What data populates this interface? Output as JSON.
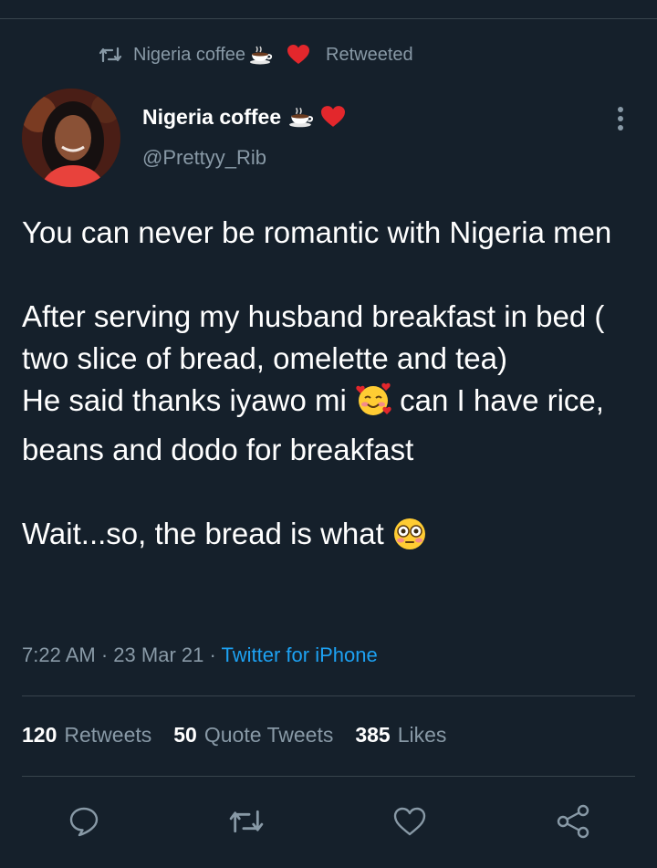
{
  "retweet_bar": {
    "name": "Nigeria coffee",
    "suffix": "Retweeted",
    "icon": "retweet-icon"
  },
  "author": {
    "name": "Nigeria coffee",
    "handle": "@Prettyy_Rib",
    "emojis": [
      "hot-beverage",
      "red-heart"
    ]
  },
  "tweet": {
    "para1": "You can never be romantic with Nigeria men",
    "para2_line1": "After serving my husband breakfast in bed ( two slice of bread, omelette and tea)",
    "para2_line2_before": "He said thanks iyawo mi",
    "para2_line2_after": "can I have rice, beans and dodo for breakfast",
    "para3_before": "Wait...so, the bread is what"
  },
  "meta": {
    "time": "7:22 AM",
    "sep": "·",
    "date": "23 Mar 21",
    "source": "Twitter for iPhone"
  },
  "stats": {
    "retweets_count": "120",
    "retweets_label": "Retweets",
    "quotes_count": "50",
    "quotes_label": "Quote Tweets",
    "likes_count": "385",
    "likes_label": "Likes"
  },
  "actions": [
    "reply-icon",
    "retweet-icon",
    "like-icon",
    "share-icon"
  ],
  "colors": {
    "background": "#15202b",
    "muted": "#8899a6",
    "link": "#1da1f2",
    "divider": "#38444d"
  }
}
